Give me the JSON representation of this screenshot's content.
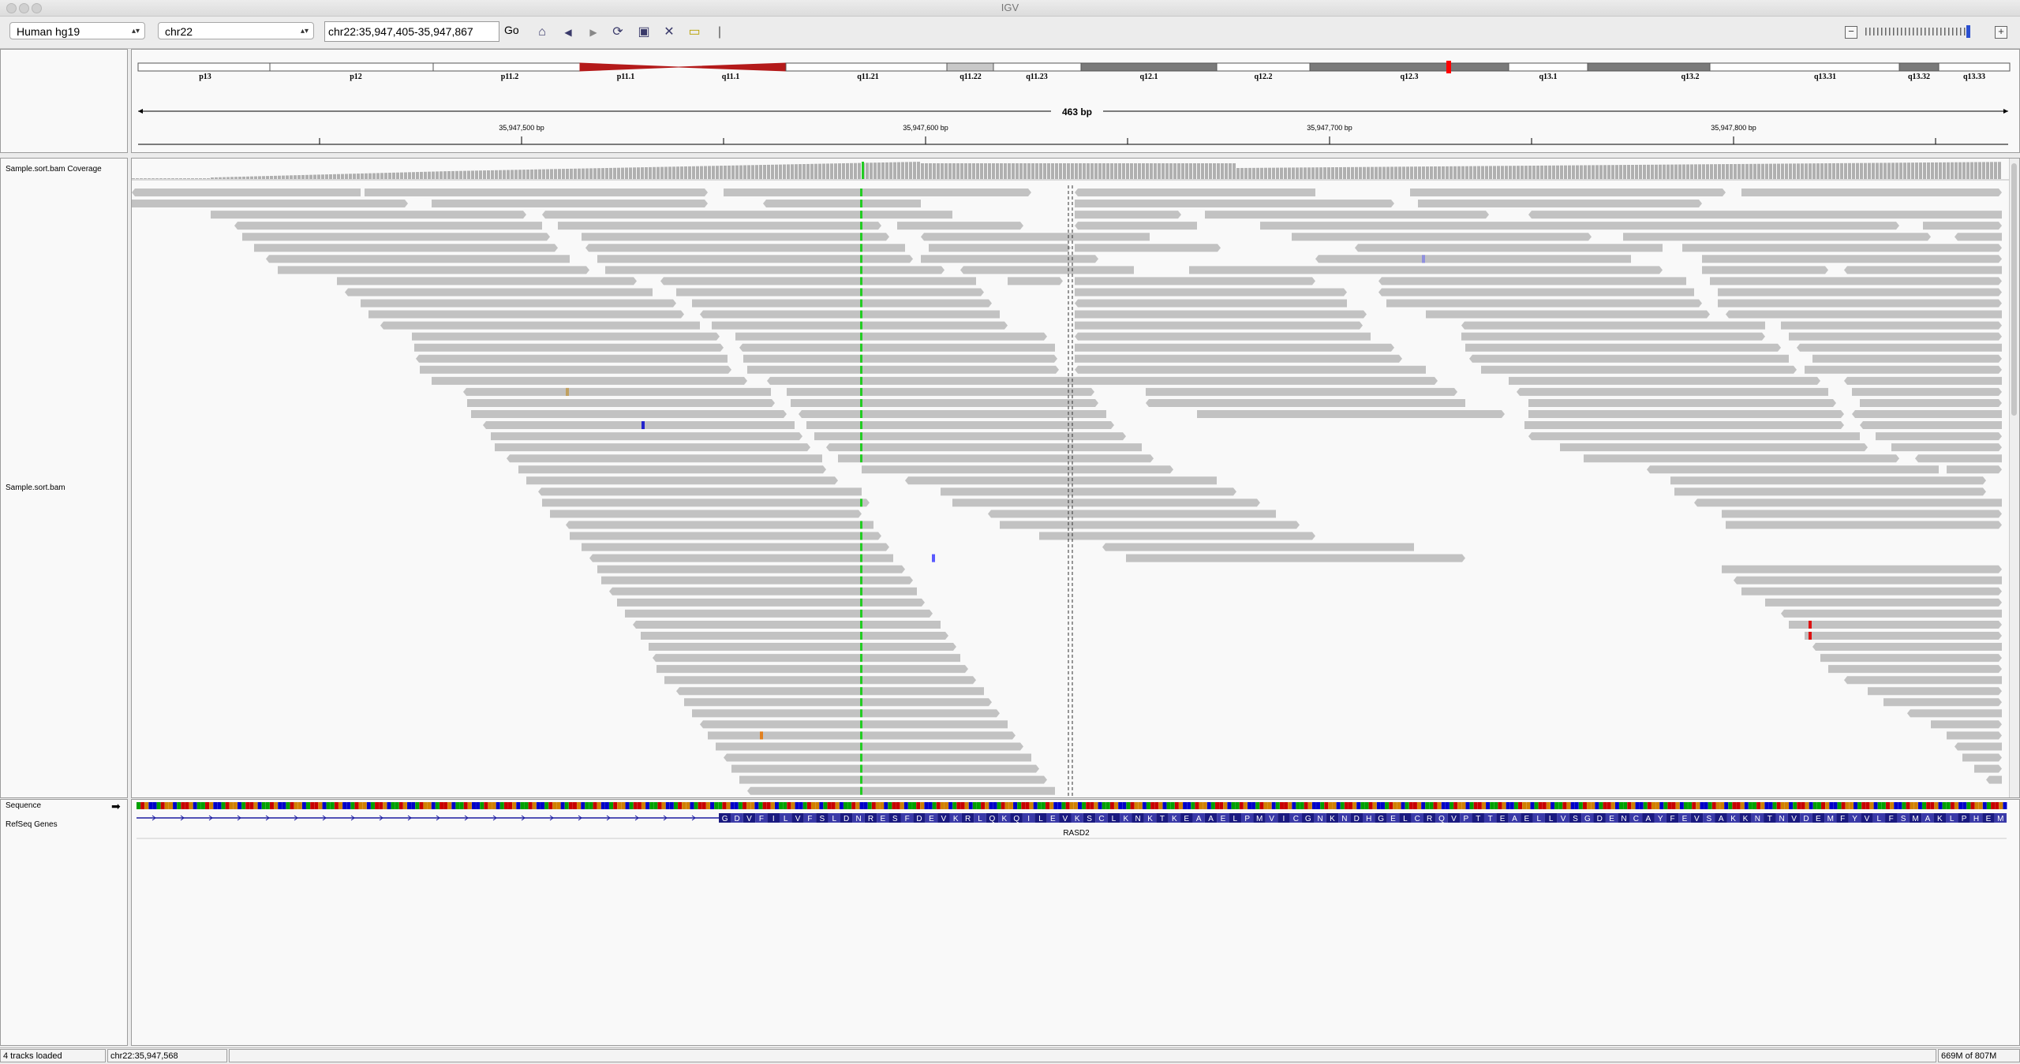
{
  "app": {
    "title": "IGV"
  },
  "toolbar": {
    "genome": "Human hg19",
    "chromosome": "chr22",
    "locus": "chr22:35,947,405-35,947,867",
    "go_label": "Go"
  },
  "ideogram": {
    "bands": [
      "p13",
      "p12",
      "p11.2",
      "p11.1",
      "q11.1",
      "q11.21",
      "q11.22",
      "q11.23",
      "q12.1",
      "q12.2",
      "q12.3",
      "q13.1",
      "q13.2",
      "q13.31",
      "q13.32",
      "q13.33"
    ]
  },
  "ruler": {
    "span_label": "463 bp",
    "ticks": [
      "35,947,500 bp",
      "35,947,600 bp",
      "35,947,700 bp",
      "35,947,800 bp"
    ]
  },
  "tracks": {
    "coverage_name": "Sample.sort.bam Coverage",
    "alignment_name": "Sample.sort.bam",
    "sequence_name": "Sequence",
    "genes_name": "RefSeq Genes",
    "gene_label": "RASD2",
    "amino_acids": "GDVFILVFSLDNRESFDEVKRLQKQILEVKSCLKNKTKEAAELPMVICGNKNDHGELCRQVPTTEAELLVSGDENCAYFEVSAKKNTNVDEMFYVLFSMAKLPHEM"
  },
  "status": {
    "tracks_loaded": "4 tracks loaded",
    "position": "chr22:35,947,568",
    "memory": "669M of 807M"
  },
  "colors": {
    "read": "#c2c2c2",
    "snp_green": "#22cc22",
    "gene_blue": "#1a1aa0",
    "accent_red": "#cc0000"
  }
}
